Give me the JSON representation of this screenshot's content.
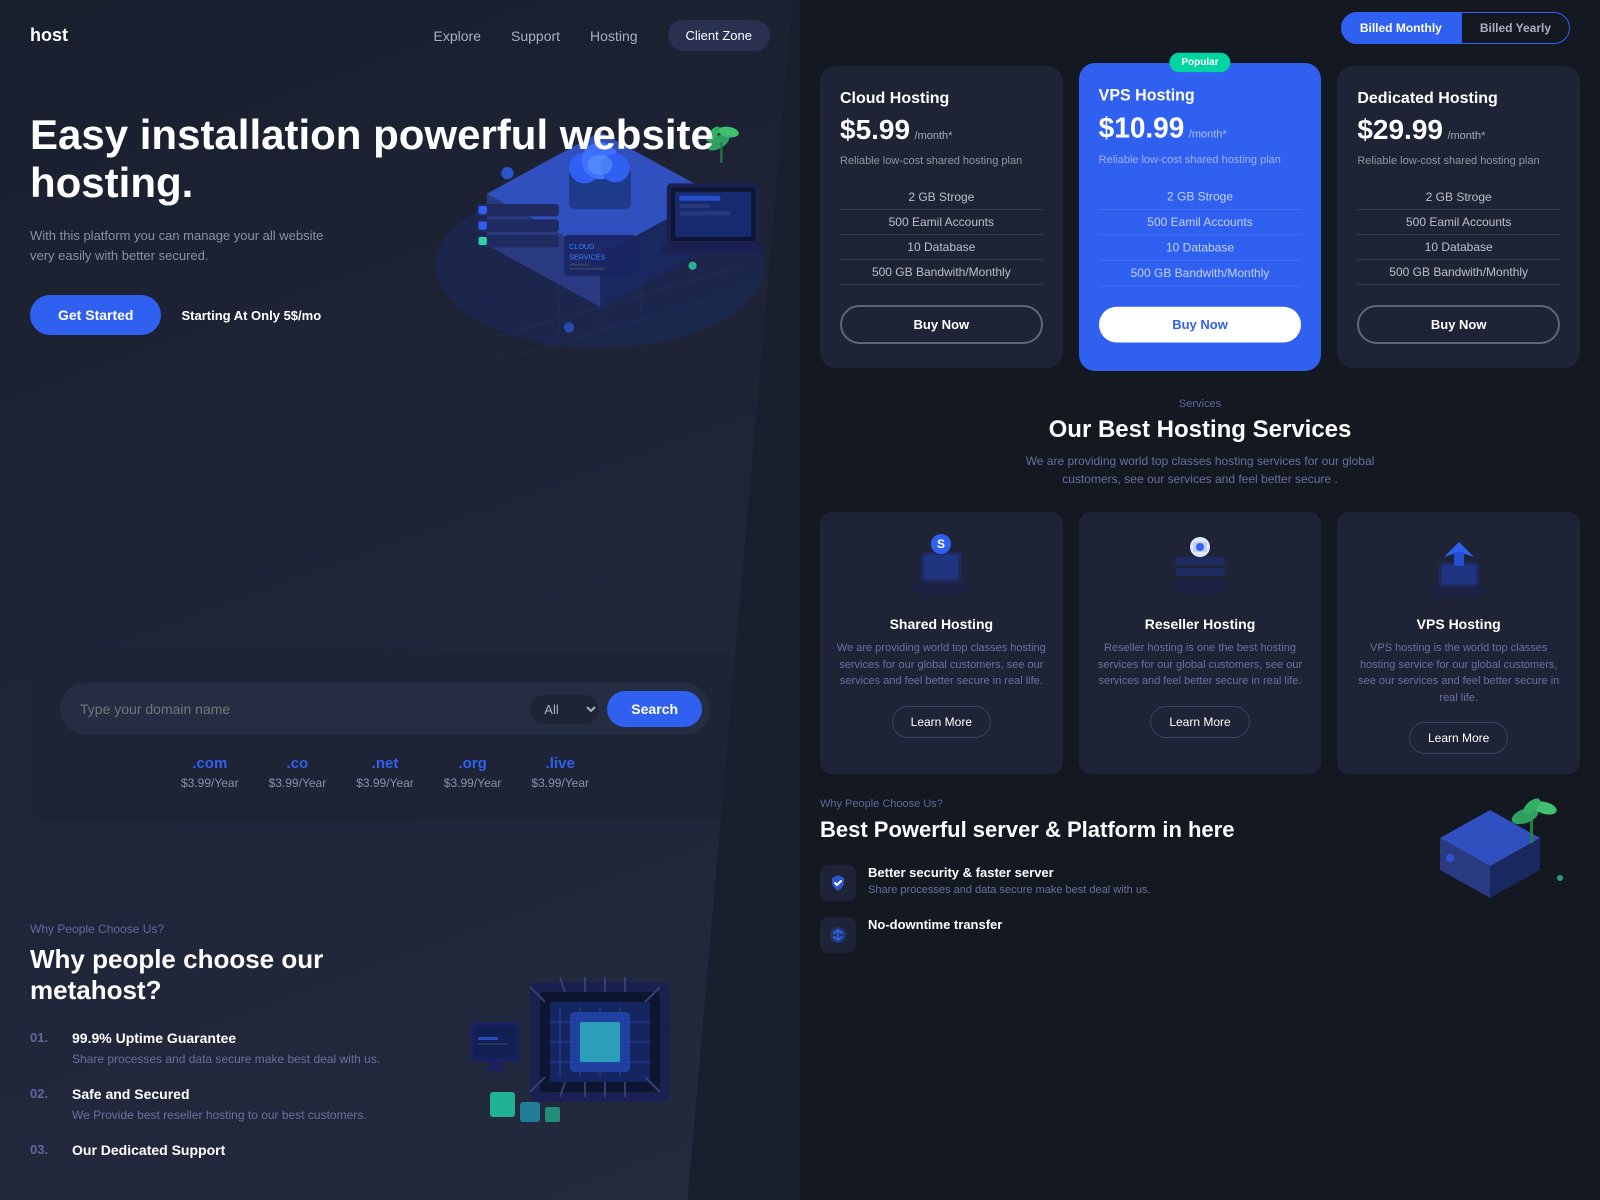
{
  "left": {
    "nav": {
      "logo": "host",
      "links": [
        "Explore",
        "Support",
        "Hosting"
      ],
      "cta": "Client Zone"
    },
    "hero": {
      "title": "Easy installation powerful website hosting.",
      "desc": "With this platform you can manage your all website very easily with better secured.",
      "cta_label": "Get Started",
      "price_label": "Starting At Only",
      "price_value": "5$/mo"
    },
    "domain": {
      "placeholder": "Type your domain name",
      "select_label": "All",
      "search_label": "Search",
      "tlds": [
        {
          "name": ".com",
          "price": "$3.99/Year"
        },
        {
          "name": ".co",
          "price": "$3.99/Year"
        },
        {
          "name": ".net",
          "price": "$3.99/Year"
        },
        {
          "name": ".org",
          "price": "$3.99/Year"
        },
        {
          "name": ".live",
          "price": "$3.99/Year"
        }
      ]
    },
    "why": {
      "label": "Why People Choose Us?",
      "title": "Why people choose our metahost?",
      "items": [
        {
          "num": "01.",
          "heading": "99.9% Uptime Guarantee",
          "desc": "Share processes and data secure make best deal with us."
        },
        {
          "num": "02.",
          "heading": "Safe and Secured",
          "desc": "We Provide best reseller hosting to our best customers."
        },
        {
          "num": "03.",
          "heading": "Our Dedicated Support",
          "desc": ""
        }
      ]
    }
  },
  "right": {
    "billing": {
      "monthly_label": "Billed Monthly",
      "yearly_label": "Billed Yearly"
    },
    "pricing": {
      "cards": [
        {
          "id": "cloud",
          "title": "Cloud Hosting",
          "price": "$5.99",
          "period": "/month*",
          "desc": "Reliable low-cost shared hosting plan",
          "features": [
            "2 GB Stroge",
            "500 Eamil Accounts",
            "10 Database",
            "500 GB Bandwith/Monthly"
          ],
          "btn": "Buy Now",
          "featured": false
        },
        {
          "id": "vps",
          "title": "VPS Hosting",
          "price": "$10.99",
          "period": "/month*",
          "desc": "Reliable low-cost shared hosting plan",
          "features": [
            "2 GB Stroge",
            "500 Eamil Accounts",
            "10 Database",
            "500 GB Bandwith/Monthly"
          ],
          "btn": "Buy Now",
          "featured": true,
          "badge": "Popular"
        },
        {
          "id": "dedicated",
          "title": "Dedicated Hosting",
          "price": "$29.99",
          "period": "/month*",
          "desc": "Reliable low-cost shared hosting plan",
          "features": [
            "2 GB Stroge",
            "500 Eamil Accounts",
            "10 Database",
            "500 GB Bandwith/Monthly"
          ],
          "btn": "Buy Now",
          "featured": false
        }
      ]
    },
    "services": {
      "label": "Services",
      "title": "Our Best Hosting Services",
      "desc": "We are providing world top classes hosting services for our global customers, see our services and feel better secure .",
      "cards": [
        {
          "id": "shared",
          "name": "Shared Hosting",
          "desc": "We are providing world top classes hosting services for our global customers, see our services and feel better secure in real life.",
          "btn": "Learn More"
        },
        {
          "id": "reseller",
          "name": "Reseller Hosting",
          "desc": "Reseller hosting is one the best hosting services for our global customers, see our services and feel better secure in real life.",
          "btn": "Learn More"
        },
        {
          "id": "vps2",
          "name": "VPS Hosting",
          "desc": "VPS hosting is the world top classes hosting service for our global customers, see our services and feel better secure in real life.",
          "btn": "Learn More"
        }
      ]
    },
    "server": {
      "label": "Why People Choose Us?",
      "title": "Best Powerful server & Platform in here",
      "features": [
        {
          "heading": "Better security & faster server",
          "desc": "Share processes and data secure make best deal with us."
        },
        {
          "heading": "No-downtime transfer",
          "desc": ""
        }
      ]
    }
  }
}
